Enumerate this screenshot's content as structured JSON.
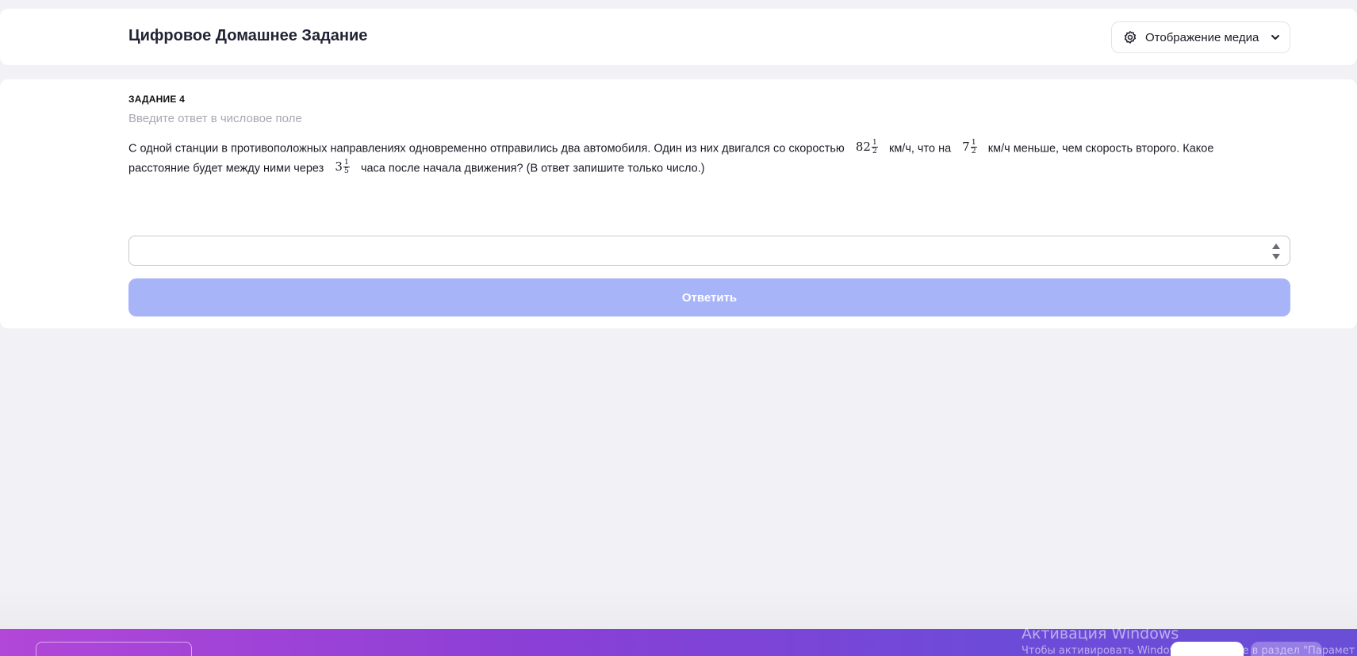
{
  "header": {
    "title": "Цифровое Домашнее Задание",
    "media_button_label": "Отображение медиа",
    "media_icon": "gear-icon",
    "dropdown_icon": "chevron-down-icon"
  },
  "task": {
    "number_label": "ЗАДАНИЕ 4",
    "hint": "Введите ответ в числовое поле",
    "text_part1": "С одной станции в противоположных направлениях одновременно отправились два автомобиля. Один из них двигался со скоростью",
    "fraction1": {
      "whole": "82",
      "num": "1",
      "den": "2"
    },
    "text_part2": "км/ч, что на",
    "fraction2": {
      "whole": "7",
      "num": "1",
      "den": "2"
    },
    "text_part3": "км/ч меньше, чем скорость второго. Какое расстояние будет между ними через",
    "fraction3": {
      "whole": "3",
      "num": "1",
      "den": "5"
    },
    "text_part4": "часа после начала движения? (В ответ запишите только число.)"
  },
  "answer": {
    "value": "",
    "placeholder": ""
  },
  "submit": {
    "label": "Ответить"
  },
  "os_overlay": {
    "title": "Активация Windows",
    "subtitle": "Чтобы активировать Windows, перейдите в раздел \"Парамет"
  },
  "colors": {
    "accent": "#a7b4f7",
    "footer_gradient_start": "#b247d8",
    "footer_gradient_end": "#6a4ed6"
  }
}
